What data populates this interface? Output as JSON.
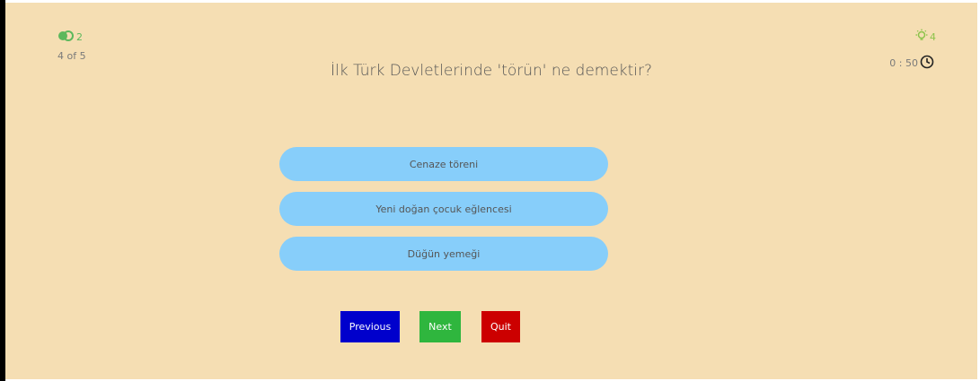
{
  "lifeline": {
    "icon": "fifty-fifty-icon",
    "count": "2",
    "color": "#5cb85c"
  },
  "counter": "4 of 5",
  "hints": {
    "icon": "lightbulb-icon",
    "count": "4",
    "color": "#8bc34a"
  },
  "timer": {
    "value": "0 : 50",
    "icon": "clock-icon"
  },
  "question": "İlk Türk Devletlerinde 'törün' ne demektir?",
  "options": [
    {
      "label": "Cenaze töreni"
    },
    {
      "label": "Yeni doğan çocuk eğlencesi"
    },
    {
      "label": "Düğün yemeği"
    }
  ],
  "buttons": {
    "previous": "Previous",
    "next": "Next",
    "quit": "Quit"
  },
  "colors": {
    "background": "#f5deb3",
    "option": "#87cefa",
    "previous": "#0000cc",
    "next": "#2fb63e",
    "quit": "#cc0000"
  }
}
